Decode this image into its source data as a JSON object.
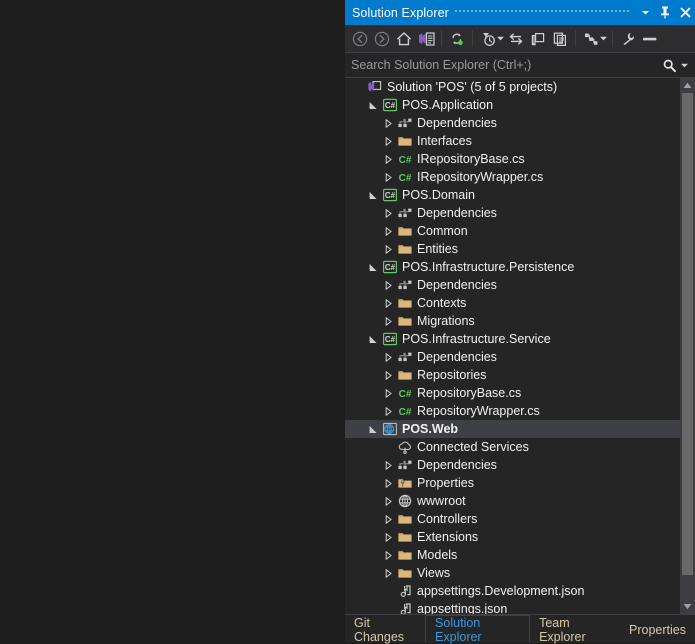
{
  "window": {
    "title": "Solution Explorer",
    "dropdown_icon": "chevron-down-icon",
    "pin_icon": "pin-icon",
    "close_icon": "close-icon",
    "accent_color": "#007acc",
    "background_color": "#252526",
    "toolbar_color": "#2d2d30",
    "selection_color": "#3f3f46"
  },
  "toolbar": {
    "items": [
      {
        "name": "back-icon",
        "tooltip": "Back"
      },
      {
        "name": "forward-icon",
        "tooltip": "Forward"
      },
      {
        "name": "home-icon",
        "tooltip": "Home"
      },
      {
        "name": "solution-explorer-icon",
        "tooltip": "Solution Explorer"
      },
      {
        "name": "sync-with-active-document-icon",
        "tooltip": "Sync with Active Document"
      },
      {
        "name": "pending-changes-filter-icon",
        "tooltip": "Pending Changes Filter"
      },
      {
        "name": "refresh-icon",
        "tooltip": "Refresh"
      },
      {
        "name": "collapse-all-icon",
        "tooltip": "Collapse All"
      },
      {
        "name": "show-all-files-icon",
        "tooltip": "Show All Files"
      },
      {
        "name": "view-code-icon",
        "tooltip": "View Code"
      },
      {
        "name": "properties-wrench-icon",
        "tooltip": "Properties"
      },
      {
        "name": "preview-selected-items-icon",
        "tooltip": "Preview Selected Items"
      }
    ]
  },
  "search": {
    "placeholder": "Search Solution Explorer (Ctrl+;)",
    "value": "",
    "search_icon": "magnifier-icon",
    "dropdown_icon": "chevron-down-icon"
  },
  "tree": {
    "nodes": [
      {
        "label": "Solution 'POS' (5 of 5 projects)",
        "icon": "solution-icon",
        "depth": 0,
        "twisty": "none",
        "selected": false,
        "bold": false
      },
      {
        "label": "POS.Application",
        "icon": "csharp-project-icon",
        "depth": 1,
        "twisty": "expanded",
        "selected": false,
        "bold": false
      },
      {
        "label": "Dependencies",
        "icon": "dependencies-icon",
        "depth": 2,
        "twisty": "collapsed",
        "selected": false,
        "bold": false
      },
      {
        "label": "Interfaces",
        "icon": "folder-icon",
        "depth": 2,
        "twisty": "collapsed",
        "selected": false,
        "bold": false
      },
      {
        "label": "IRepositoryBase.cs",
        "icon": "csharp-file-icon",
        "depth": 2,
        "twisty": "collapsed",
        "selected": false,
        "bold": false
      },
      {
        "label": "IRepositoryWrapper.cs",
        "icon": "csharp-file-icon",
        "depth": 2,
        "twisty": "collapsed",
        "selected": false,
        "bold": false
      },
      {
        "label": "POS.Domain",
        "icon": "csharp-project-icon",
        "depth": 1,
        "twisty": "expanded",
        "selected": false,
        "bold": false
      },
      {
        "label": "Dependencies",
        "icon": "dependencies-icon",
        "depth": 2,
        "twisty": "collapsed",
        "selected": false,
        "bold": false
      },
      {
        "label": "Common",
        "icon": "folder-icon",
        "depth": 2,
        "twisty": "collapsed",
        "selected": false,
        "bold": false
      },
      {
        "label": "Entities",
        "icon": "folder-icon",
        "depth": 2,
        "twisty": "collapsed",
        "selected": false,
        "bold": false
      },
      {
        "label": "POS.Infrastructure.Persistence",
        "icon": "csharp-project-icon",
        "depth": 1,
        "twisty": "expanded",
        "selected": false,
        "bold": false
      },
      {
        "label": "Dependencies",
        "icon": "dependencies-icon",
        "depth": 2,
        "twisty": "collapsed",
        "selected": false,
        "bold": false
      },
      {
        "label": "Contexts",
        "icon": "folder-icon",
        "depth": 2,
        "twisty": "collapsed",
        "selected": false,
        "bold": false
      },
      {
        "label": "Migrations",
        "icon": "folder-icon",
        "depth": 2,
        "twisty": "collapsed",
        "selected": false,
        "bold": false
      },
      {
        "label": "POS.Infrastructure.Service",
        "icon": "csharp-project-icon",
        "depth": 1,
        "twisty": "expanded",
        "selected": false,
        "bold": false
      },
      {
        "label": "Dependencies",
        "icon": "dependencies-icon",
        "depth": 2,
        "twisty": "collapsed",
        "selected": false,
        "bold": false
      },
      {
        "label": "Repositories",
        "icon": "folder-icon",
        "depth": 2,
        "twisty": "collapsed",
        "selected": false,
        "bold": false
      },
      {
        "label": "RepositoryBase.cs",
        "icon": "csharp-file-icon",
        "depth": 2,
        "twisty": "collapsed",
        "selected": false,
        "bold": false
      },
      {
        "label": "RepositoryWrapper.cs",
        "icon": "csharp-file-icon",
        "depth": 2,
        "twisty": "collapsed",
        "selected": false,
        "bold": false
      },
      {
        "label": "POS.Web",
        "icon": "web-project-icon",
        "depth": 1,
        "twisty": "expanded",
        "selected": true,
        "bold": true
      },
      {
        "label": "Connected Services",
        "icon": "connected-services-icon",
        "depth": 2,
        "twisty": "none",
        "selected": false,
        "bold": false
      },
      {
        "label": "Dependencies",
        "icon": "dependencies-icon",
        "depth": 2,
        "twisty": "collapsed",
        "selected": false,
        "bold": false
      },
      {
        "label": "Properties",
        "icon": "properties-folder-icon",
        "depth": 2,
        "twisty": "collapsed",
        "selected": false,
        "bold": false
      },
      {
        "label": "wwwroot",
        "icon": "globe-icon",
        "depth": 2,
        "twisty": "collapsed",
        "selected": false,
        "bold": false
      },
      {
        "label": "Controllers",
        "icon": "folder-icon",
        "depth": 2,
        "twisty": "collapsed",
        "selected": false,
        "bold": false
      },
      {
        "label": "Extensions",
        "icon": "folder-icon",
        "depth": 2,
        "twisty": "collapsed",
        "selected": false,
        "bold": false
      },
      {
        "label": "Models",
        "icon": "folder-icon",
        "depth": 2,
        "twisty": "collapsed",
        "selected": false,
        "bold": false
      },
      {
        "label": "Views",
        "icon": "folder-icon",
        "depth": 2,
        "twisty": "collapsed",
        "selected": false,
        "bold": false
      },
      {
        "label": "appsettings.Development.json",
        "icon": "json-file-icon",
        "depth": 2,
        "twisty": "none",
        "selected": false,
        "bold": false
      },
      {
        "label": "appsettings.json",
        "icon": "json-file-icon",
        "depth": 2,
        "twisty": "none",
        "selected": false,
        "bold": false
      }
    ]
  },
  "scrollbar": {
    "up_arrow_icon": "scroll-up-icon",
    "down_arrow_icon": "scroll-down-icon",
    "orientation": "vertical"
  },
  "tabs": [
    {
      "label": "Git Changes",
      "active": false
    },
    {
      "label": "Solution Explorer",
      "active": true
    },
    {
      "label": "Team Explorer",
      "active": false
    },
    {
      "label": "Properties",
      "active": false
    }
  ]
}
